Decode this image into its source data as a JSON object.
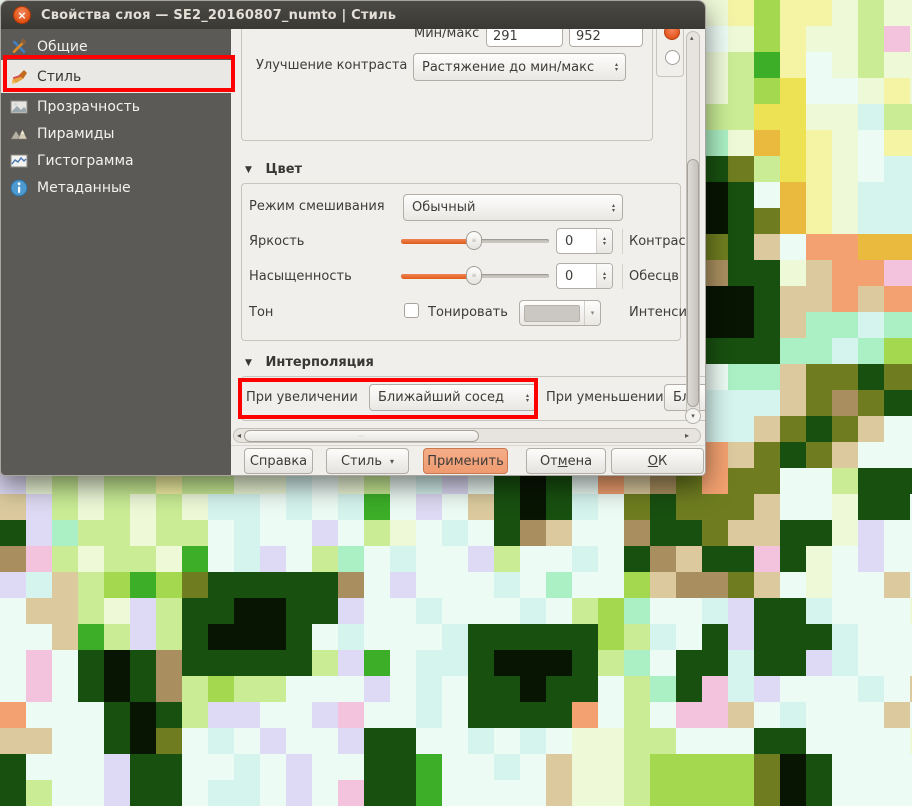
{
  "window": {
    "title": "Свойства слоя — SE2_20160807_numto | Стиль"
  },
  "icons": {
    "close": "×",
    "spin_up": "▴",
    "spin_down": "▾",
    "dropdown_arrow": "▾",
    "section_triangle": "▼",
    "scroll_up": "▲",
    "scroll_down": "▼",
    "scroll_left": "◂",
    "scroll_right": "▸",
    "thumb_grip": "⋯"
  },
  "sidebar": {
    "items": [
      {
        "label": "Общие",
        "icon": "tools-icon"
      },
      {
        "label": "Стиль",
        "icon": "paintbrush-icon",
        "selected": true,
        "annotated": true
      },
      {
        "label": "Прозрачность",
        "icon": "transparency-icon"
      },
      {
        "label": "Пирамиды",
        "icon": "pyramids-icon"
      },
      {
        "label": "Гистограмма",
        "icon": "histogram-icon"
      },
      {
        "label": "Метаданные",
        "icon": "info-icon"
      }
    ]
  },
  "panel": {
    "minmax": {
      "label": "Мин/макс",
      "min": "291",
      "max": "952"
    },
    "contrast_enhancement": {
      "label": "Улучшение контраста",
      "value": "Растяжение до мин/макс"
    },
    "color_section": {
      "title": "Цвет",
      "blend_mode": {
        "label": "Режим смешивания",
        "value": "Обычный"
      },
      "brightness": {
        "label": "Яркость",
        "value": "0",
        "right_label": "Контрас"
      },
      "saturation": {
        "label": "Насыщенность",
        "value": "0",
        "right_label": "Обесцв"
      },
      "hue": {
        "label": "Тон",
        "checkbox_label": "Тонировать",
        "right_label": "Интенси"
      }
    },
    "interpolation_section": {
      "title": "Интерполяция",
      "zoomed_in": {
        "label": "При увеличении",
        "value": "Ближайший сосед"
      },
      "zoomed_out": {
        "label": "При уменьшении",
        "value": "Бл"
      }
    }
  },
  "buttons": {
    "help": "Справка",
    "style": "Стиль",
    "apply": "Применить",
    "cancel_pre": "От",
    "cancel_mn": "м",
    "cancel_post": "ена",
    "ok_mn": "О",
    "ok_post": "К"
  },
  "colors": {
    "accent_orange": "#e95420",
    "annotation_red": "#fe0000",
    "titlebar": "#3a3934",
    "sidebar_bg": "#5b5a56",
    "dialog_bg": "#f0efec"
  },
  "background_raster": {
    "cell_size": 26,
    "palette": {
      "W": "#edfbf5",
      "C": "#d6f4ee",
      "L": "#ded9f4",
      "P": "#f3c3de",
      "A": "#eef9d8",
      "G": "#c9ec95",
      "g": "#a4d84e",
      "E": "#3cae28",
      "m": "#abefc4",
      "Y": "#f5f3a4",
      "y": "#ece253",
      "O": "#e9ba3e",
      "o": "#f3a170",
      "t": "#dcca9e",
      "b": "#a98f5f",
      "d": "#6f7d20",
      "D": "#185010",
      "K": "#081503"
    },
    "rows": [
      "WWWWWWWWWWWWWWWWWWWWWWWWWWWAYgYYAGAA",
      "WWWWWWWWWWWWWWWWWWWWWWWWWWWWAgYAAGPA",
      "WWWWWWWWWWWWWWWWWWWWWWWWWWWAGEYWAGAA",
      "WWWWWWWWWWWWWWWWWWWWWWWWWWWAGgyWWAYA",
      "WWWWWWWWWWWWWWWWWWWWWWWWWWWGGyyAACGG",
      "WWWWWWWWWWWWWWWWWWWWWWWWWWWmAOyYAWYY",
      "WWWWWWWWWWWWWWWWWWWWWWWWWWWDdGyYAWCC",
      "WWWWWWWWWWWWWWWWWWWWWWWWWWWKDWOYACCC",
      "WWWWWWWWWWWWWWWWWWWWWWWWWWWKDdOYACCC",
      "WWWWWWWWWWWWWWWWWWWWWWWWWWWdDtWooOOO",
      "WWWWWWWWWWWWWWWWWWWWWWWWWWWbDDAtooPP",
      "WWWWWWWWWWWWWWWWWWWWWWWWWWWKKDttotoo",
      "WWWWWWWWWWWWWWWWWWWWWWWWWWWKKDtmmCmm",
      "WWWWWWWWWWWWWWWWWWWWWWWWWWWDDDmmCmgg",
      "WWWWWWWWWWWWWWWWWWWWWWWWWWWWmmtddDdd",
      "WWWWWWWWWWWWWWWWWWWWWWWWWWWCCCtdbdDD",
      "WWWWWWWWWWWWWWWWWWWWWWWWWWWCCtdDdtWW",
      "WWWWWWWWWWWWWWWWWWWWWWWWWWWotdDdtWWW",
      "LAGAGGYGGAACWAGWCLWDKDWotbdoddWWGDDD",
      "tLGAGAGACCWCWCEWLWtDKDCWdDdddtWWADDW",
      "DLmGGAGGWCWWLWGAWCWDbtWWbDDdttDDALWW",
      "bPGAGGAEWCLWGmWCWWLGWWCWDbtDDPDAWLWW",
      "LCtGgEgdDDDDDbWLWWWCWmWWgtbbdtWAWWtW",
      "WttGALGDDKKDDLWWCWWWCWGgmWWCLDDCWWWA",
      "WWtEGLGDKKKDWCWWWCDDDDDgGCWDLDDDCWWW",
      "WPWDKDbDDDDDGLEWCCDKKKDGmWDDCDDLCWWW",
      "WPWDKDbGgGGWWWLWCWDDKDDWGmDPCLWWWCWt",
      "oWWWDKDGLLWWLPWWCWDDDDoWGWPPtWCWWWtW",
      "ttWWDKdWCWLWWLDDWWCWCWAAGGWWWDDWWWWA",
      "DWWWLDDWWCWLWWDDEWWCWtAAGggggdKDWWWW",
      "DGWWLDDWCCWLWPDDEWWWWtAAGggggdKDWWWW"
    ]
  }
}
